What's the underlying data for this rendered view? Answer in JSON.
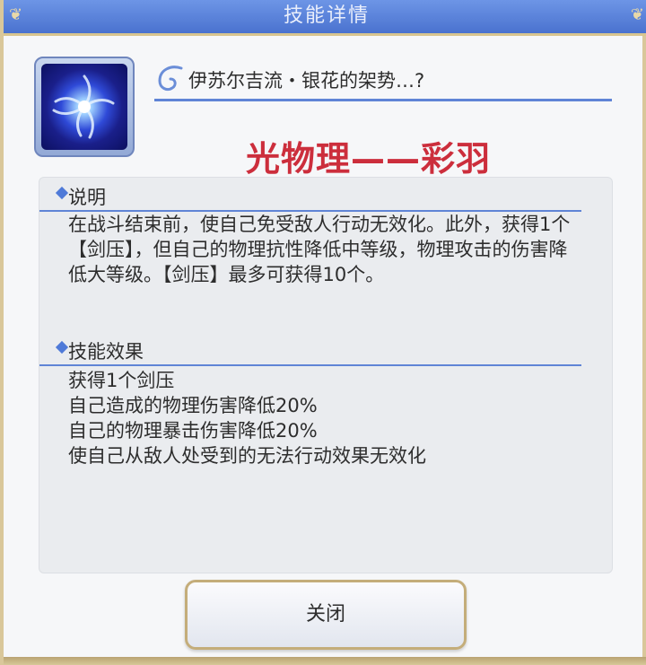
{
  "window": {
    "title": "技能详情"
  },
  "skill": {
    "icon": "swirl-vortex-icon",
    "name": "伊苏尔吉流・银花的架势…?",
    "subtitle": "光物理——彩羽"
  },
  "description": {
    "header": "说明",
    "text": "在战斗结束前，使自己免受敌人行动无效化。此外，获得1个【剑压】，但自己的物理抗性降低中等级，物理攻击的伤害降低大等级。【剑压】最多可获得10个。"
  },
  "effects": {
    "header": "技能效果",
    "items": [
      "获得1个剑压",
      "自己造成的物理伤害降低20%",
      "自己的物理暴击伤害降低20%",
      "使自己从敌人处受到的无法行动效果无效化"
    ]
  },
  "buttons": {
    "close_label": "关闭"
  },
  "colors": {
    "title_bar": "#5a82d8",
    "accent_line": "#5f84d6",
    "subtitle_red": "#cc2e3c",
    "gold_trim": "#d9c79a"
  }
}
